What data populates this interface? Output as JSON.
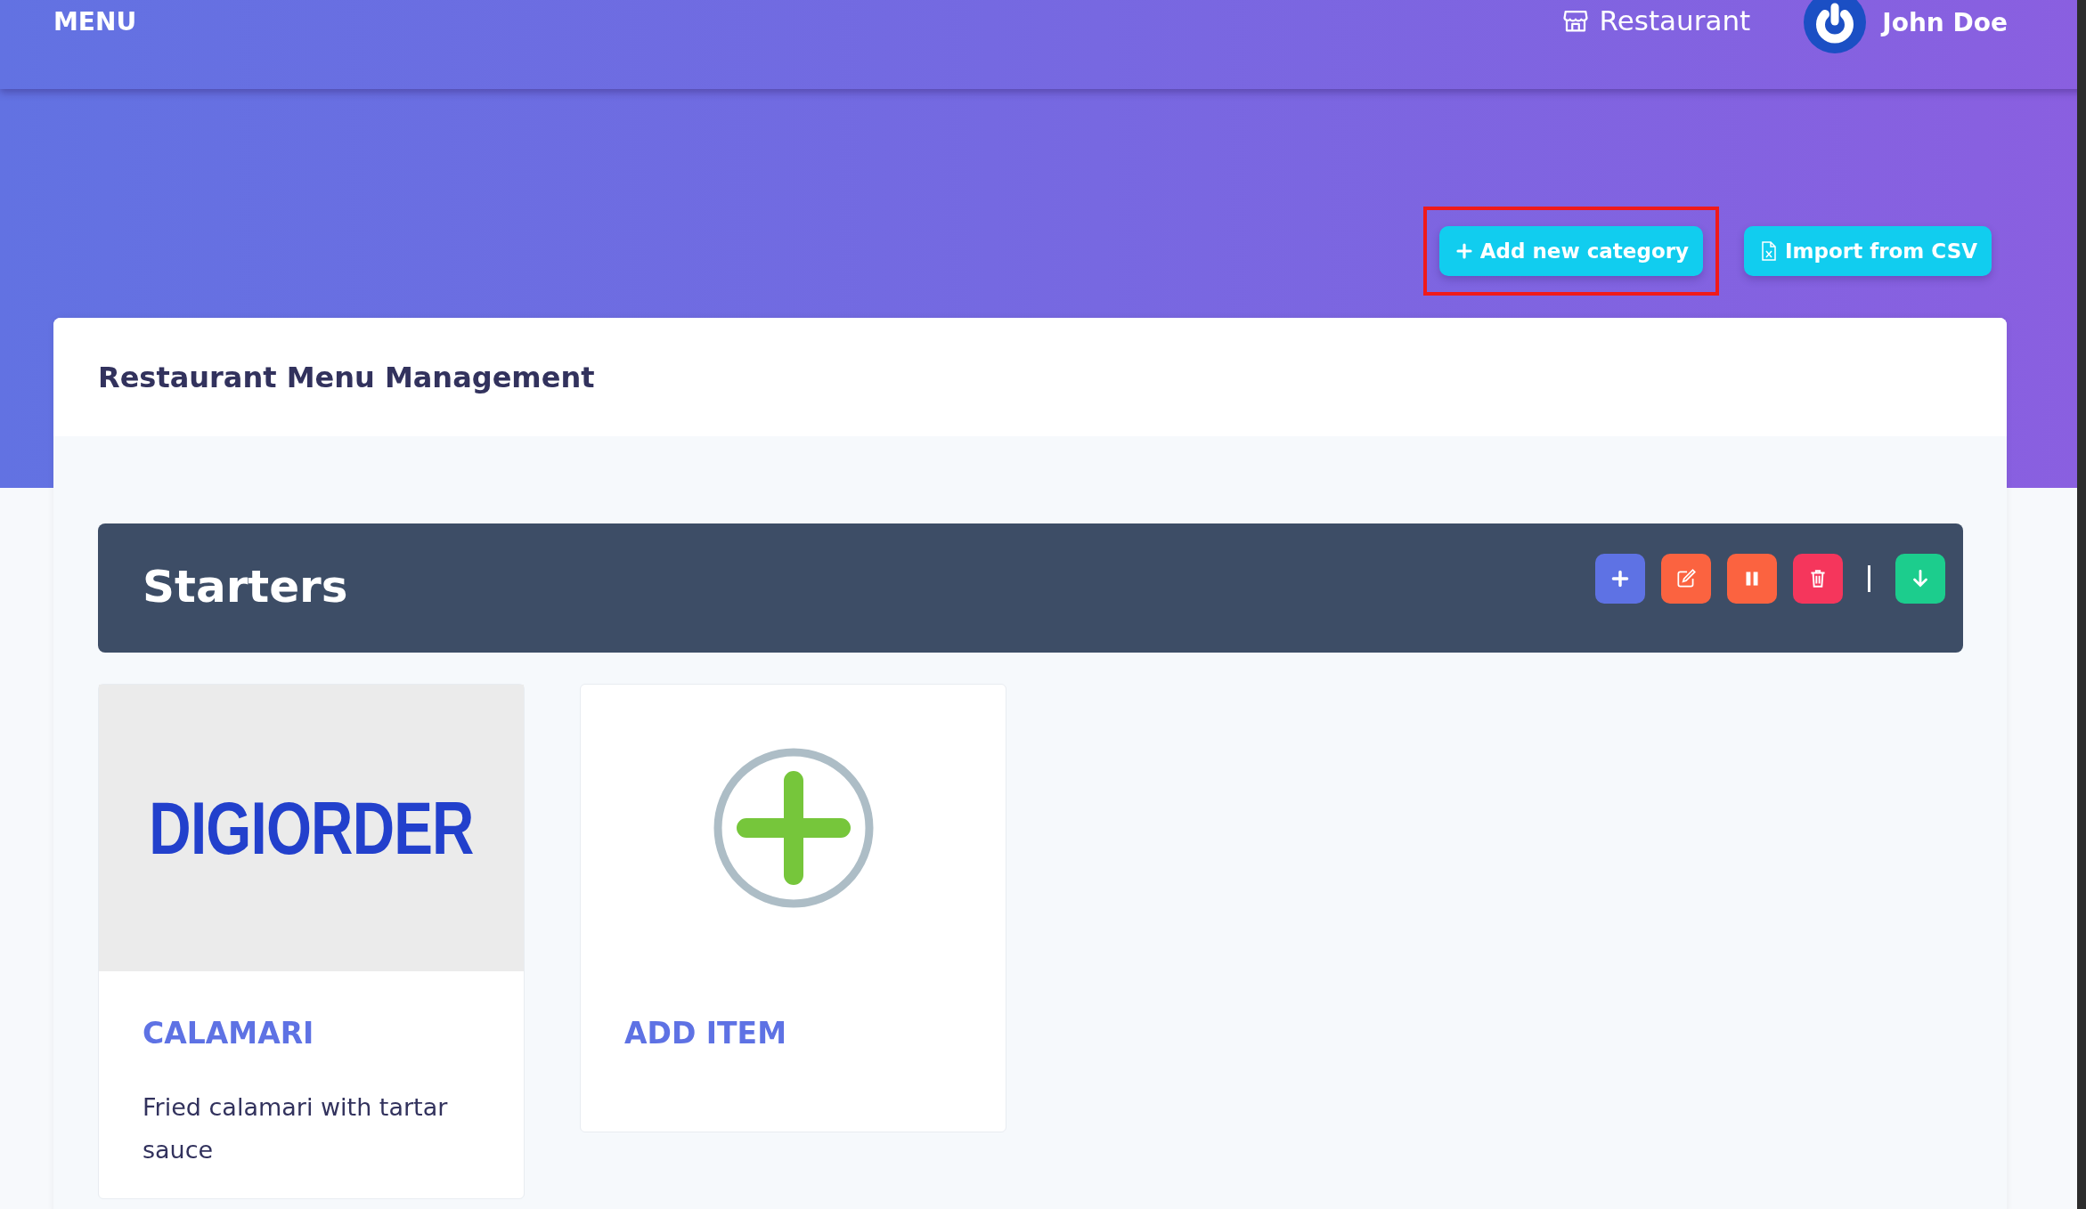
{
  "navbar": {
    "brand": "MENU",
    "restaurant_link": "Restaurant",
    "user_name": "John Doe"
  },
  "actions": [
    {
      "kind": "add",
      "label": "Add new category",
      "highlighted": true
    },
    {
      "kind": "import",
      "label": "Import from CSV",
      "highlighted": false
    }
  ],
  "panel": {
    "title": "Restaurant Menu Management"
  },
  "categories": [
    {
      "name": "Starters",
      "tools": [
        {
          "kind": "add",
          "color": "#5e72e4"
        },
        {
          "kind": "edit",
          "color": "#fb6340"
        },
        {
          "kind": "pause",
          "color": "#fb6340"
        },
        {
          "kind": "delete",
          "color": "#f5365c"
        },
        {
          "kind": "separator"
        },
        {
          "kind": "down",
          "color": "#1ccd8d"
        }
      ],
      "items": [
        {
          "kind": "item",
          "image_text": "DIGIORDER",
          "title": "CALAMARI",
          "description": "Fried calamari with tartar sauce"
        },
        {
          "kind": "add",
          "title": "ADD ITEM"
        }
      ]
    }
  ]
}
